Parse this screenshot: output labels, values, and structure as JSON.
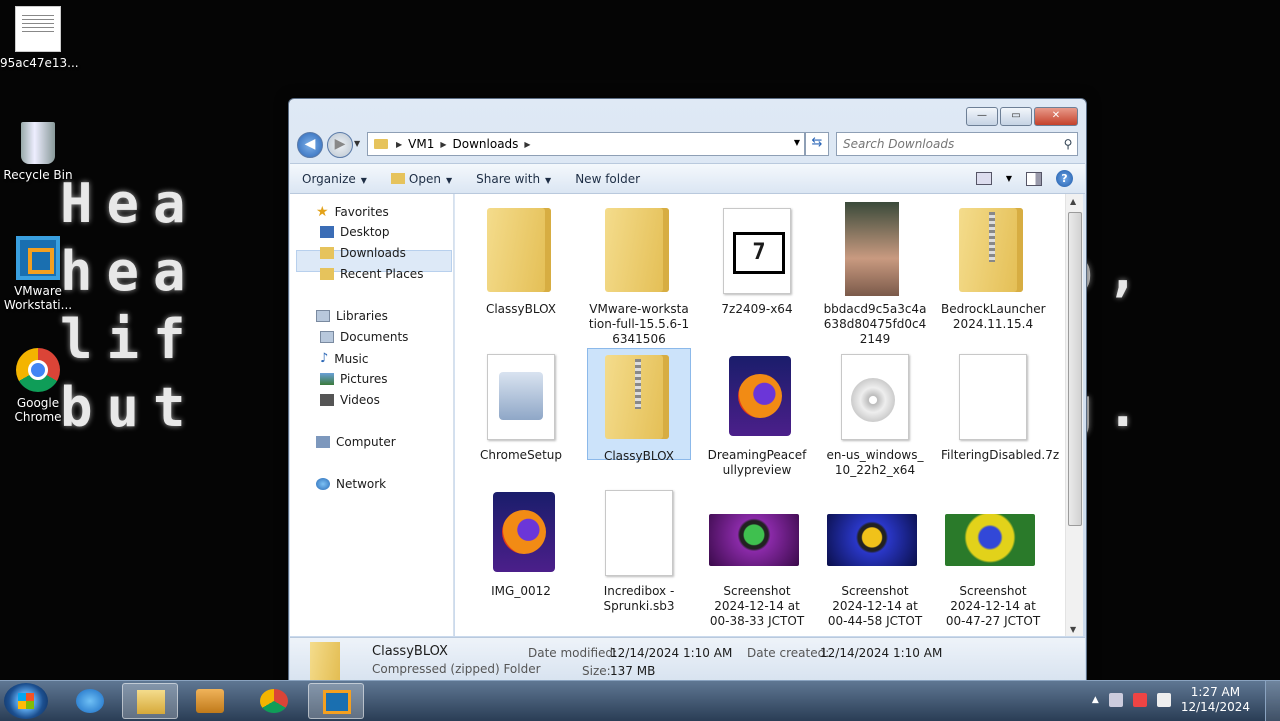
{
  "desktop": {
    "wallpaper_lines": [
      "Hea",
      "hea",
      "lif",
      "but"
    ],
    "wallpaper_right": [
      ",",
      "p,",
      ",",
      "g."
    ],
    "icons": [
      {
        "label": "95ac47e13...",
        "icon": "note-icon"
      },
      {
        "label": "Recycle Bin",
        "icon": "recycle-bin-icon"
      },
      {
        "label": "VMware Workstati...",
        "icon": "vmware-icon"
      },
      {
        "label": "Google Chrome",
        "icon": "chrome-icon"
      }
    ]
  },
  "window": {
    "controls": {
      "minimize": "—",
      "maximize": "▭",
      "close": "✕"
    },
    "breadcrumb": [
      "VM1",
      "Downloads"
    ],
    "search_placeholder": "Search Downloads",
    "toolbar": {
      "organize": "Organize",
      "open": "Open",
      "share_with": "Share with",
      "new_folder": "New folder",
      "help": "?"
    },
    "nav": {
      "favorites": "Favorites",
      "desktop": "Desktop",
      "downloads": "Downloads",
      "recent_places": "Recent Places",
      "libraries": "Libraries",
      "documents": "Documents",
      "music": "Music",
      "pictures": "Pictures",
      "videos": "Videos",
      "computer": "Computer",
      "network": "Network"
    },
    "files": [
      {
        "name": "ClassyBLOX",
        "type": "folder"
      },
      {
        "name": "VMware-workstation-full-15.5.6-16341506",
        "type": "folder-open"
      },
      {
        "name": "7z2409-x64",
        "type": "7z-installer"
      },
      {
        "name": "bbdacd9c5a3c4a638d80475fd0c42149",
        "type": "photo"
      },
      {
        "name": "BedrockLauncher 2024.11.15.4",
        "type": "zip"
      },
      {
        "name": "ChromeSetup",
        "type": "setup"
      },
      {
        "name": "ClassyBLOX",
        "type": "zip",
        "selected": true
      },
      {
        "name": "DreamingPeacefullypreview",
        "type": "firefox-doc"
      },
      {
        "name": "en-us_windows_10_22h2_x64",
        "type": "disc-image"
      },
      {
        "name": "FilteringDisabled.7z",
        "type": "blank"
      },
      {
        "name": "IMG_0012",
        "type": "firefox-doc"
      },
      {
        "name": "Incredibox - Sprunki.sb3",
        "type": "blank"
      },
      {
        "name": "Screenshot 2024-12-14 at 00-38-33 JCTOT",
        "type": "shot1"
      },
      {
        "name": "Screenshot 2024-12-14 at 00-44-58 JCTOT",
        "type": "shot2"
      },
      {
        "name": "Screenshot 2024-12-14 at 00-47-27 JCTOT",
        "type": "shot3"
      }
    ],
    "details": {
      "name": "ClassyBLOX",
      "type": "Compressed (zipped) Folder",
      "modified_label": "Date modified:",
      "modified_value": "12/14/2024 1:10 AM",
      "size_label": "Size:",
      "size_value": "137 MB",
      "created_label": "Date created:",
      "created_value": "12/14/2024 1:10 AM"
    }
  },
  "taskbar": {
    "time": "1:27 AM",
    "date": "12/14/2024"
  }
}
